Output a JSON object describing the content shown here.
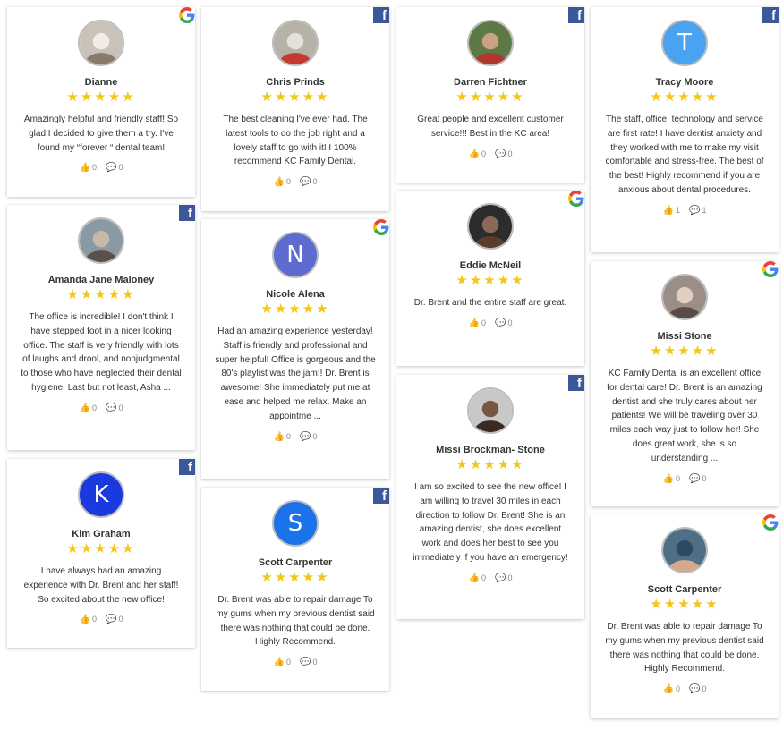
{
  "colors": {
    "star": "#f5c518",
    "facebook": "#3b5998"
  },
  "cards": [
    {
      "name": "Dianne",
      "source": "google",
      "avatar": "photo-bulldog",
      "rating": 5,
      "text": "Amazingly helpful and friendly staff! So glad I decided to give them a try. I've found my “forever “ dental team!",
      "likes": "0",
      "comments": "0"
    },
    {
      "name": "Amanda Jane Maloney",
      "source": "facebook",
      "avatar": "photo-woman",
      "rating": 5,
      "text": "The office is incredible! I don't think I have stepped foot in a nicer looking office. The staff is very friendly with lots of laughs and drool, and nonjudgmental to those who have neglected their dental hygiene. Last but not least, Asha ...",
      "likes": "0",
      "comments": "0"
    },
    {
      "name": "Kim Graham",
      "source": "facebook",
      "avatar": "K",
      "avatar_color": "#1a3adf",
      "rating": 5,
      "text": "I have always had an amazing experience with Dr. Brent and her staff! So excited about the new office!",
      "likes": "0",
      "comments": "0"
    },
    {
      "name": "Chris Prinds",
      "source": "facebook",
      "avatar": "photo-group",
      "rating": 5,
      "text": "The best cleaning I've ever had. The latest tools to do the job right and a lovely staff to go with it! I 100% recommend KC Family Dental.",
      "likes": "0",
      "comments": "0"
    },
    {
      "name": "Nicole Alena",
      "source": "google",
      "avatar": "N",
      "avatar_color": "#5e6bcf",
      "rating": 5,
      "text": "Had an amazing experience yesterday! Staff is friendly and professional and super helpful! Office is gorgeous and the 80's playlist was the jam!! Dr. Brent is awesome! She immediately put me at ease and helped me relax. Make an appointme ...",
      "likes": "0",
      "comments": "0"
    },
    {
      "name": "Scott Carpenter",
      "source": "facebook",
      "avatar": "S",
      "avatar_color": "#1a73e8",
      "rating": 5,
      "text": "Dr. Brent was able to repair damage To my gums when my previous dentist said there was nothing that could be done. Highly Recommend.",
      "likes": "0",
      "comments": "0"
    },
    {
      "name": "Darren Fichtner",
      "source": "facebook",
      "avatar": "photo-man-red",
      "rating": 5,
      "text": "Great people and excellent customer service!!! Best in the KC area!",
      "likes": "0",
      "comments": "0"
    },
    {
      "name": "Eddie McNeil",
      "source": "google",
      "avatar": "photo-man-dark",
      "rating": 5,
      "text": "Dr. Brent and the entire staff are great.",
      "likes": "0",
      "comments": "0"
    },
    {
      "name": "Missi Brockman- Stone",
      "source": "facebook",
      "avatar": "photo-woman-dark",
      "rating": 5,
      "text": "I am so excited to see the new office! I am willing to travel 30 miles in each direction to follow Dr. Brent! She is an amazing dentist, she does excellent work and does her best to see you immediately if you have an emergency!",
      "likes": "0",
      "comments": "0"
    },
    {
      "name": "Tracy Moore",
      "source": "facebook",
      "avatar": "T",
      "avatar_color": "#4aa3f0",
      "rating": 5,
      "text": "The staff, office, technology and service are first rate! I have dentist anxiety and they worked with me to make my visit comfortable and stress-free. The best of the best! Highly recommend if you are anxious about dental procedures.",
      "likes": "1",
      "comments": "1"
    },
    {
      "name": "Missi Stone",
      "source": "google",
      "avatar": "photo-woman-smile",
      "rating": 5,
      "text": "KC Family Dental is an excellent office for dental care! Dr. Brent is an amazing dentist and she truly cares about her patients! We will be traveling over 30 miles each way just to follow her! She does great work, she is so understanding ...",
      "likes": "0",
      "comments": "0"
    },
    {
      "name": "Scott Carpenter",
      "source": "google",
      "avatar": "photo-man-blue",
      "rating": 5,
      "text": "Dr. Brent was able to repair damage To my gums when my previous dentist said there was nothing that could be done. Highly Recommend.",
      "likes": "0",
      "comments": "0"
    }
  ]
}
